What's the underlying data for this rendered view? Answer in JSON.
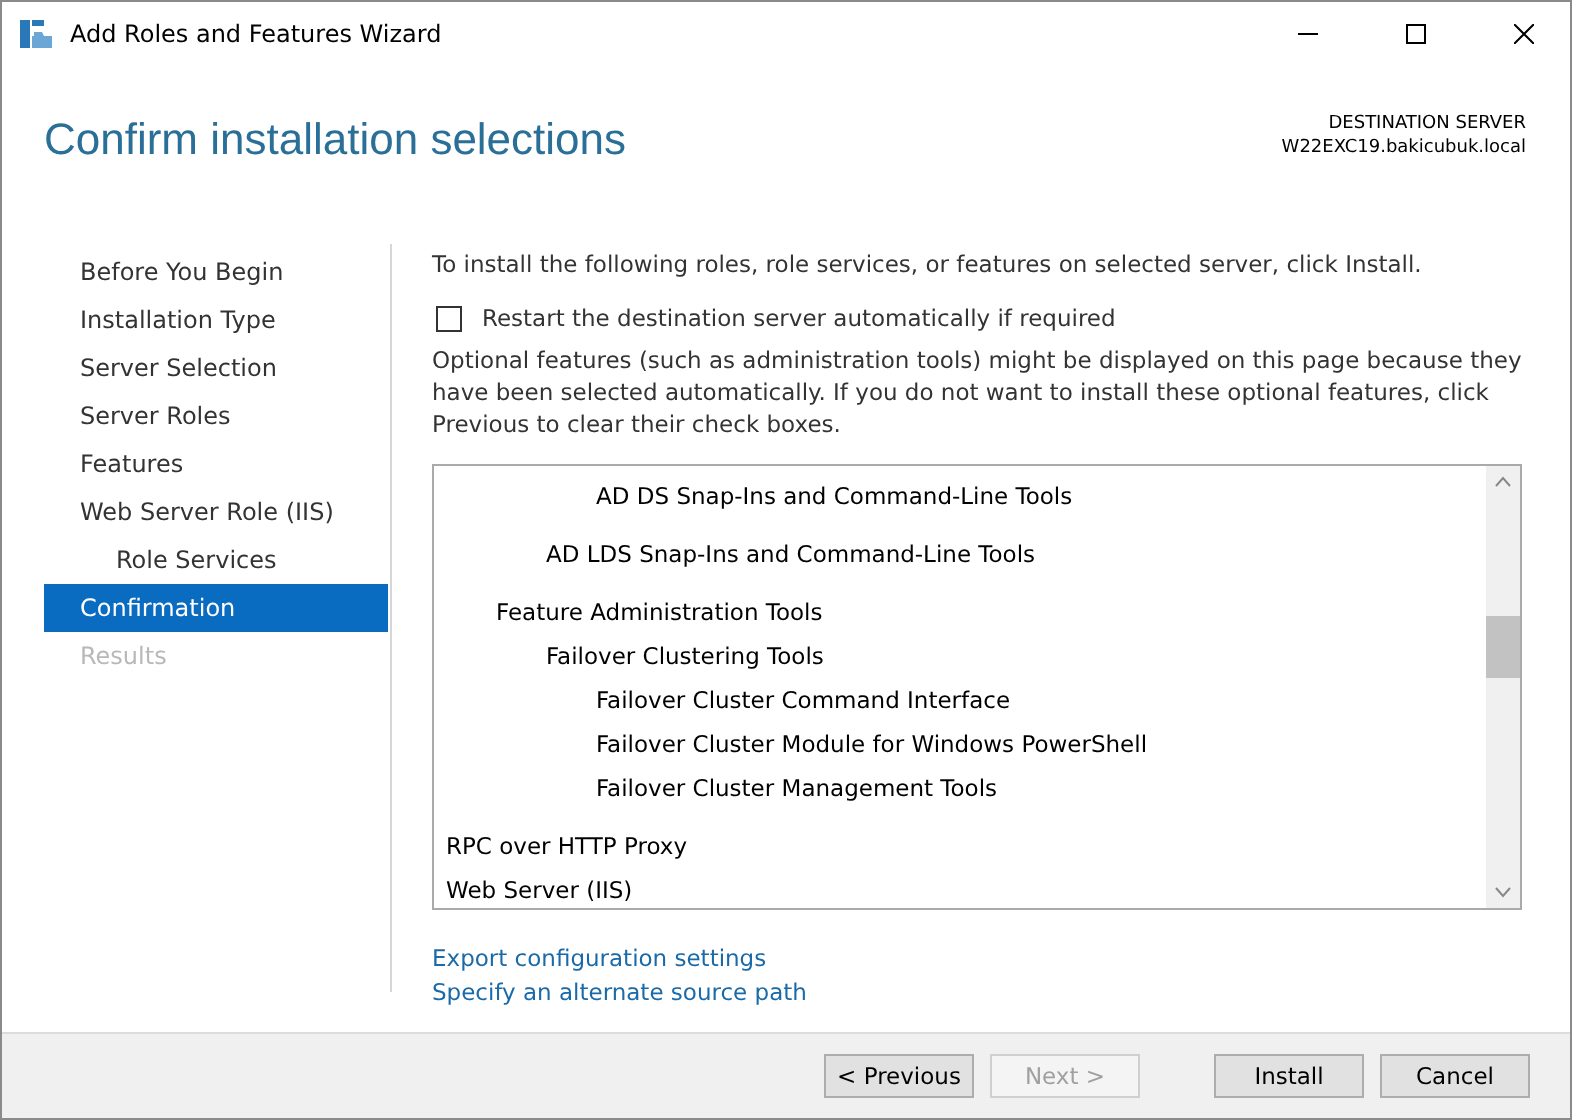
{
  "window": {
    "title": "Add Roles and Features Wizard"
  },
  "header": {
    "title": "Confirm installation selections",
    "server_label": "DESTINATION SERVER",
    "server_name": "W22EXC19.bakicubuk.local"
  },
  "sidebar": {
    "items": [
      {
        "label": "Before You Begin",
        "selected": false,
        "disabled": false
      },
      {
        "label": "Installation Type",
        "selected": false,
        "disabled": false
      },
      {
        "label": "Server Selection",
        "selected": false,
        "disabled": false
      },
      {
        "label": "Server Roles",
        "selected": false,
        "disabled": false
      },
      {
        "label": "Features",
        "selected": false,
        "disabled": false
      },
      {
        "label": "Web Server Role (IIS)",
        "selected": false,
        "disabled": false,
        "children": [
          {
            "label": "Role Services",
            "selected": false,
            "disabled": false
          }
        ]
      },
      {
        "label": "Confirmation",
        "selected": true,
        "disabled": false
      },
      {
        "label": "Results",
        "selected": false,
        "disabled": true
      }
    ]
  },
  "content": {
    "intro": "To install the following roles, role services, or features on selected server, click Install.",
    "restart_checkbox": {
      "label": "Restart the destination server automatically if required",
      "checked": false
    },
    "note": "Optional features (such as administration tools) might be displayed on this page because they have been selected automatically. If you do not want to install these optional features, click Previous to clear their check boxes.",
    "selections": [
      {
        "children": [
          {
            "children": [
              {
                "children": [
                  {
                    "label": "AD DS Snap-Ins and Command-Line Tools"
                  }
                ]
              },
              {
                "label": "AD LDS Snap-Ins and Command-Line Tools"
              }
            ]
          },
          {
            "label": "Feature Administration Tools",
            "children": [
              {
                "label": "Failover Clustering Tools",
                "children": [
                  {
                    "label": "Failover Cluster Command Interface"
                  },
                  {
                    "label": "Failover Cluster Module for Windows PowerShell"
                  },
                  {
                    "label": "Failover Cluster Management Tools"
                  }
                ]
              }
            ]
          }
        ]
      },
      {
        "label": "RPC over HTTP Proxy"
      },
      {
        "label": "Web Server (IIS)"
      }
    ],
    "links": [
      "Export configuration settings",
      "Specify an alternate source path"
    ]
  },
  "buttons": [
    {
      "label": "< Previous",
      "disabled": false
    },
    {
      "label": "Next >",
      "disabled": true
    },
    {
      "label": "Install",
      "disabled": false
    },
    {
      "label": "Cancel",
      "disabled": false
    }
  ]
}
